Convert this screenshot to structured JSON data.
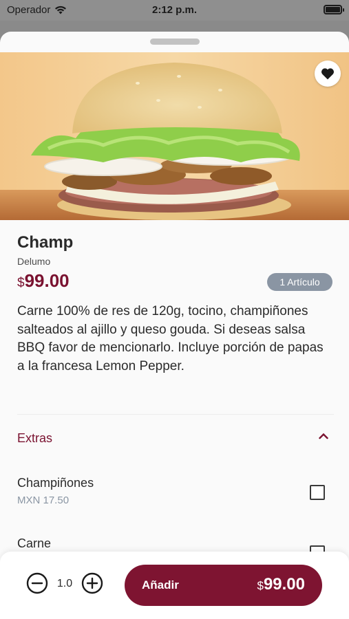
{
  "status_bar": {
    "carrier": "Operador",
    "time": "2:12 p.m."
  },
  "product": {
    "name": "Champ",
    "brand": "Delumo",
    "price_currency": "$",
    "price_value": "99.00",
    "quantity_badge": "1 Artículo",
    "description": "Carne 100% de res de 120g, tocino, champiñones salteados al ajillo y queso gouda. Si deseas salsa BBQ favor de mencionarlo. Incluye porción de papas a la francesa Lemon Pepper.",
    "image_icon": "burger-photo"
  },
  "extras": {
    "label": "Extras",
    "expanded": true,
    "items": [
      {
        "name": "Champiñones",
        "price": "MXN 17.50",
        "checked": false
      },
      {
        "name": "Carne",
        "price": "",
        "checked": false
      }
    ]
  },
  "bottom_bar": {
    "quantity": "1.0",
    "add_label": "Añadir",
    "total_currency": "$",
    "total_value": "99.00"
  },
  "colors": {
    "accent": "#7e1431",
    "badge": "#8a95a3",
    "muted_text": "#8a95a3"
  },
  "icons": {
    "wifi": "wifi-icon",
    "battery": "battery-icon",
    "favorite": "heart-icon",
    "collapse": "chevron-up-icon",
    "decrement": "minus-circle-icon",
    "increment": "plus-circle-icon"
  }
}
